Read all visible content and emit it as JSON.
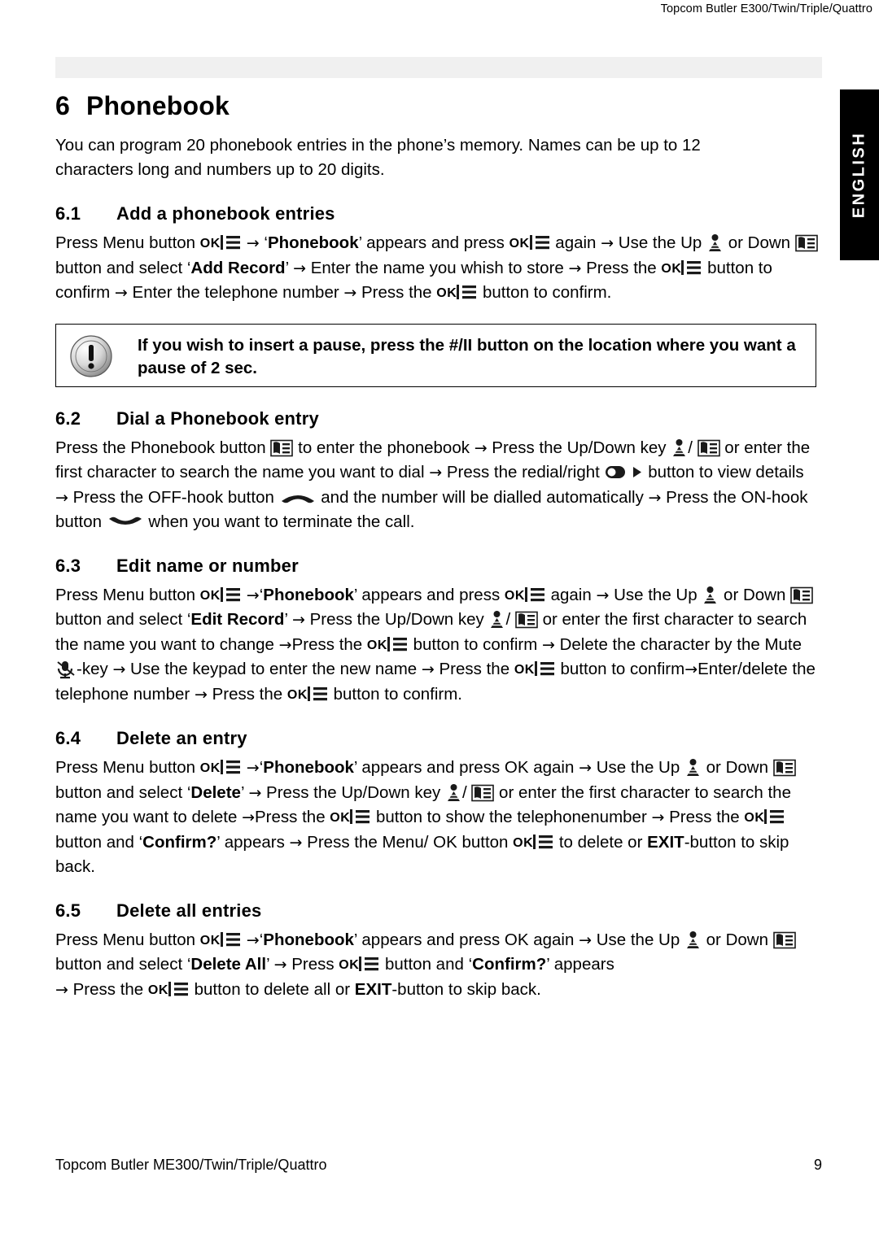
{
  "header": {
    "right_text": "Topcom Butler E300/Twin/Triple/Quattro",
    "side_tab": "ENGLISH"
  },
  "chapter": {
    "number": "6",
    "title": "Phonebook"
  },
  "intro": "You can program 20 phonebook entries in the phone’s memory. Names can be up to 12 characters long and numbers up to 20 digits.",
  "sections": [
    {
      "number": "6.1",
      "title": "Add a phonebook entries",
      "t1": "Press Menu button ",
      "t2": " ‘",
      "b1": "Phonebook",
      "t3": "’ appears and press ",
      "t4": " again ",
      "t5": "  Use the Up ",
      "t6": " or Down ",
      "t7": " button and select ‘",
      "b2": "Add Record",
      "t8": "’ ",
      "t9": " Enter the name you whish to store ",
      "t10": " Press the ",
      "t11": " button to confirm ",
      "t12": " Enter the telephone number ",
      "t13": " Press the ",
      "t14": " button to confirm."
    },
    {
      "number": "6.2",
      "title": "Dial a Phonebook entry",
      "t1": "Press the Phonebook button ",
      "t2": " to enter the phonebook ",
      "t3": " Press the Up/Down key ",
      "t4": "/ ",
      "t5": " or enter the first character to search the name you want to dial ",
      "t6": " Press the redial/right ",
      "t7": " button to view details ",
      "t8": " Press the OFF-hook button ",
      "t9": " and the number will be dialled automatically ",
      "t10": " Press the ON-hook button ",
      "t11": " when you want to terminate the call."
    },
    {
      "number": "6.3",
      "title": "Edit name or number",
      "t1": "Press Menu button ",
      "t2": "‘",
      "b1": "Phonebook",
      "t3": "’ appears and press ",
      "t4": " again ",
      "t5": "  Use the Up ",
      "t6": " or Down ",
      "t7": " button and select ‘",
      "b2": "Edit Record",
      "t8": "’ ",
      "t9": " Press the Up/Down key ",
      "t10": "/ ",
      "t11": " or enter the first character to search the name you want to change ",
      "t12": "Press the ",
      "t13": " button to confirm ",
      "t14": " Delete the character by the Mute ",
      "t15": "-key ",
      "t16": " Use the keypad to enter the new name ",
      "t17": " Press the ",
      "t18": " button to confirm",
      "t19": "Enter/delete the telephone number ",
      "t20": " Press the ",
      "t21": " button to confirm."
    },
    {
      "number": "6.4",
      "title": "Delete an entry",
      "t1": "Press Menu button ",
      "t2": "‘",
      "b1": "Phonebook",
      "t3": "’ appears and press OK again ",
      "t4": "  Use the Up ",
      "t5": " or Down ",
      "t6": " button and select ‘",
      "b2": "Delete",
      "t7": "’ ",
      "t8": " Press the Up/Down key ",
      "t9": "/ ",
      "t10": " or enter the first character to search the name you want to delete ",
      "t11": "Press the ",
      "t12": " button to show the telephonenumber ",
      "t13": " Press the ",
      "t14": " button and ‘",
      "b3": "Confirm?",
      "t15": "’ appears ",
      "t16": " Press the Menu/ OK button ",
      "t17": " to delete or ",
      "b4": "EXIT",
      "t18": "-button to skip back."
    },
    {
      "number": "6.5",
      "title": "Delete all entries",
      "t1": "Press Menu button ",
      "t2": "‘",
      "b1": "Phonebook",
      "t3": "’ appears and press OK again ",
      "t4": "  Use the Up ",
      "t5": " or Down ",
      "t6": " button and select ‘",
      "b2": "Delete All",
      "t7": "’ ",
      "t8": " Press ",
      "t9": " button and ‘",
      "b3": "Confirm?",
      "t10": "’ appears ",
      "t11": " Press the ",
      "t12": " button to delete all or ",
      "b4": "EXIT",
      "t13": "-button to skip back."
    }
  ],
  "note": {
    "text": "If you wish to insert a pause, press the #/II button on the location where you want a pause of 2 sec.",
    "icon": "exclamation-icon"
  },
  "labels": {
    "ok": "OK"
  },
  "footer": {
    "left": "Topcom Butler ME300/Twin/Triple/Quattro",
    "page": "9"
  }
}
